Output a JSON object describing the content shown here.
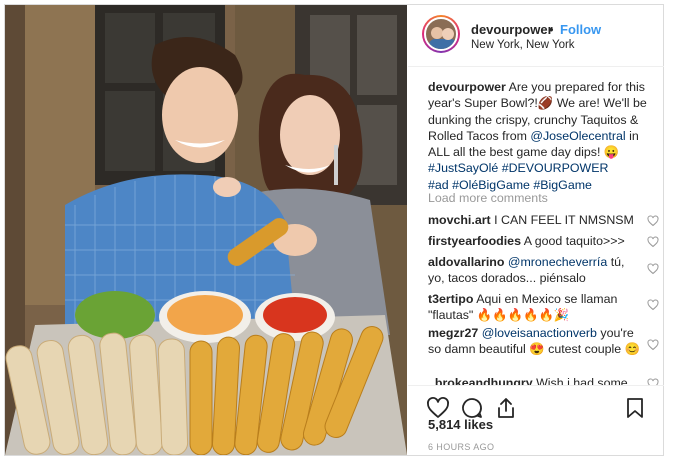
{
  "post": {
    "username": "devourpower",
    "separator": "•",
    "follow_label": "Follow",
    "location": "New York, New York",
    "avatar_icon": "profile-avatar"
  },
  "caption": {
    "username": "devourpower",
    "text_1": "Are you prepared for this year's Super Bowl?!",
    "emoji_1": "🏈",
    "text_2": " We are! We'll be dunking the crispy, crunchy Taquitos & Rolled Tacos from ",
    "mention": "@JoseOlecentral",
    "text_3": " in ALL all the best game day dips! ",
    "emoji_2": "😛",
    "hashtags_1": "#JustSayOlé #DEVOURPOWER",
    "hashtags_2": "#ad #OléBigGame #BigGame"
  },
  "load_more_label": "Load more comments",
  "comments": [
    {
      "username": "movchi.art",
      "text": "I CAN FEEL IT NMSNSM"
    },
    {
      "username": "firstyearfoodies",
      "text": "A good taquito>>>"
    },
    {
      "username": "aldovallarino",
      "mention": "@mronecheverría",
      "text": " tú, yo, tacos dorados... piénsalo"
    },
    {
      "username": "t3ertipo",
      "text": "Aqui en Mexico se llaman \"flautas\" 🔥🔥🔥🔥🔥🎉"
    },
    {
      "username": "megzr27",
      "mention": "@loveisanactionverb",
      "text": " you're so damn beautiful 😍 cutest couple 😊"
    },
    {
      "username": "_brokeandhungry",
      "text": "Wish i had some"
    }
  ],
  "actions": {
    "like_icon": "heart-outline-icon",
    "comment_icon": "comment-bubble-icon",
    "share_icon": "share-upload-icon",
    "save_icon": "bookmark-icon"
  },
  "likes": "5,814 likes",
  "timestamp": "6 HOURS AGO",
  "colors": {
    "link": "#003569",
    "follow": "#3897f0",
    "muted": "#999999",
    "text": "#262626"
  }
}
